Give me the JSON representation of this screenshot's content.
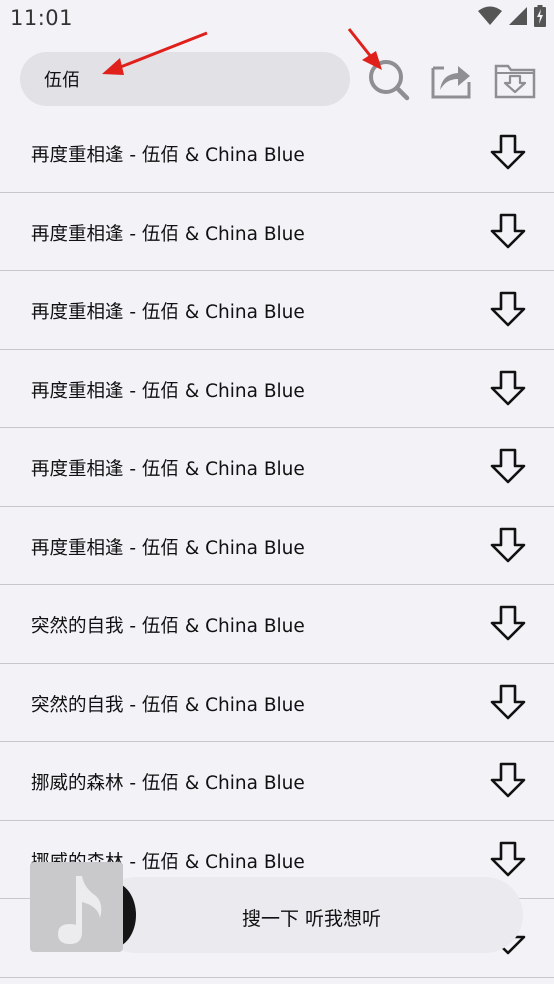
{
  "status_bar": {
    "time": "11:01",
    "icons": [
      "wifi-icon",
      "signal-icon",
      "battery-charging-icon"
    ]
  },
  "search": {
    "value": "伍佰"
  },
  "toolbar": {
    "icons": [
      "search-icon",
      "share-icon",
      "save-icon"
    ]
  },
  "songs": [
    {
      "title": "再度重相逢 - 伍佰 & China Blue"
    },
    {
      "title": "再度重相逢 - 伍佰 & China Blue"
    },
    {
      "title": "再度重相逢 - 伍佰 & China Blue"
    },
    {
      "title": "再度重相逢 - 伍佰 & China Blue"
    },
    {
      "title": "再度重相逢 - 伍佰 & China Blue"
    },
    {
      "title": "再度重相逢 - 伍佰 & China Blue"
    },
    {
      "title": "突然的自我 - 伍佰 & China Blue"
    },
    {
      "title": "突然的自我 - 伍佰 & China Blue"
    },
    {
      "title": "挪威的森林 - 伍佰 & China Blue"
    },
    {
      "title": "挪威的森林 - 伍佰 & China Blue"
    },
    {
      "title": ""
    }
  ],
  "player": {
    "text": "搜一下 听我想听",
    "icon": "music-note-icon"
  },
  "colors": {
    "background": "#f2f2f7",
    "search_bg": "#e1e1e6",
    "icon_gray": "#8e8e93",
    "annotation_red": "#e0201b"
  }
}
